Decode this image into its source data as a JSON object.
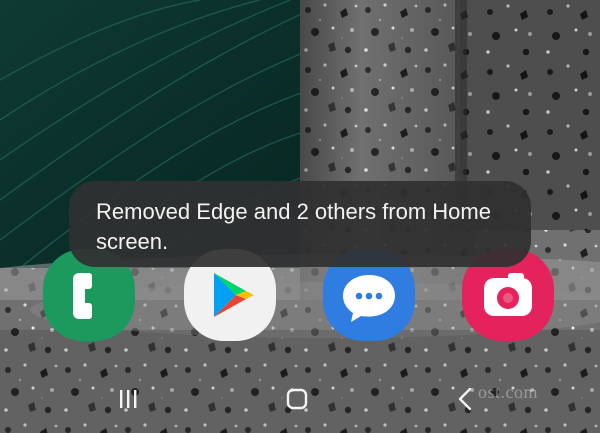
{
  "toast": {
    "message": "Removed Edge and 2 others from Home screen."
  },
  "dock": {
    "apps": [
      {
        "icon": "phone-icon",
        "color": "#1c9a5e"
      },
      {
        "icon": "play-store-icon",
        "color": "#f1f1f1"
      },
      {
        "icon": "messages-icon",
        "color": "#2f7de1"
      },
      {
        "icon": "camera-icon",
        "color": "#e4235c"
      }
    ]
  },
  "navigation": {
    "buttons": [
      "recent-apps",
      "home",
      "back"
    ]
  },
  "watermark": {
    "text": "ost.com"
  }
}
